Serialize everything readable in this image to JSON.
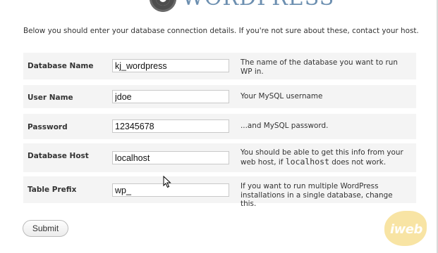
{
  "header": {
    "logo_text": "WordPress",
    "intro": "Below you should enter your database connection details. If you're not sure about these, contact your host."
  },
  "form": {
    "rows": [
      {
        "label": "Database Name",
        "value": "kj_wordpress",
        "help": "The name of the database you want to run WP in."
      },
      {
        "label": "User Name",
        "value": "jdoe",
        "help": "Your MySQL username"
      },
      {
        "label": "Password",
        "value": "12345678",
        "help": "...and MySQL password."
      },
      {
        "label": "Database Host",
        "value": "localhost",
        "help_before": "You should be able to get this info from your web host, if ",
        "help_code": "localhost",
        "help_after": " does not work."
      },
      {
        "label": "Table Prefix",
        "value": "wp_",
        "help": "If you want to run multiple WordPress installations in a single database, change this."
      }
    ],
    "submit_label": "Submit"
  },
  "watermark": {
    "text": "iweb"
  }
}
